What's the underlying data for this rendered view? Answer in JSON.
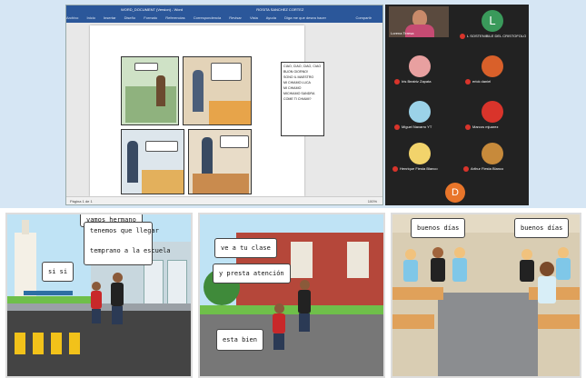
{
  "word": {
    "title": "WORD_DOCUMENT (Version) - Word",
    "title_right": "ROSITA SANCHEZ CORTEZ",
    "ribbon_tabs": [
      "Archivo",
      "Inicio",
      "Insertar",
      "Diseño",
      "Formato",
      "Referencias",
      "Correspondencia",
      "Revisar",
      "Vista",
      "Ayuda",
      "Diga me que desea hacer"
    ],
    "share": "Compartir",
    "status": "Página 1 de 1",
    "zoom_label": "100%",
    "textbox_lines": [
      "CIAO, CIAO, CIAO, CIAO",
      "BUON GIORNO!",
      "SONO IL MAESTRO",
      "MI CHIAMO LUCA",
      "MI CHIAMO",
      "MICHIAMO SANDRA",
      "COME TI CHIAMI?"
    ]
  },
  "meeting": {
    "participants": [
      {
        "name": "Lorena Teresa",
        "color": "#c98a6a",
        "initial": ""
      },
      {
        "name": "L SOSTENIBILE DEL CRISTOFOLO",
        "color": "#3a9a5b",
        "initial": "L"
      },
      {
        "name": "Iris Beatriz Zapata",
        "color": "#e8a0a0",
        "initial": ""
      },
      {
        "name": "erick daniel",
        "color": "#d9602a",
        "initial": ""
      },
      {
        "name": "Miguel Navarro YT",
        "color": "#9bd2e8",
        "initial": ""
      },
      {
        "name": "Marcos mjuarez",
        "color": "#d9342b",
        "initial": ""
      },
      {
        "name": "Henrique Fiesta Blanco",
        "color": "#f2d36b",
        "initial": ""
      },
      {
        "name": "Arthur Fiesta Blanco",
        "color": "#c78a3b",
        "initial": ""
      },
      {
        "name": "",
        "color": "#e8752a",
        "initial": "D"
      }
    ]
  },
  "comic": {
    "panel1": {
      "bubble_top": "vamos hermano",
      "bubble_main_1": "tenemos que llegar",
      "bubble_main_2": "temprano a la escuela",
      "bubble_left": "si si"
    },
    "panel2": {
      "bubble_1": "ve a tu clase",
      "bubble_2": "y presta atención",
      "bubble_3": "esta bien"
    },
    "panel3": {
      "bubble_left": "buenos días",
      "bubble_right": "buenos días"
    }
  },
  "colors": {
    "word_blue": "#2b579a",
    "zoom_bg": "#222222",
    "mic_off": "#d9342b"
  }
}
